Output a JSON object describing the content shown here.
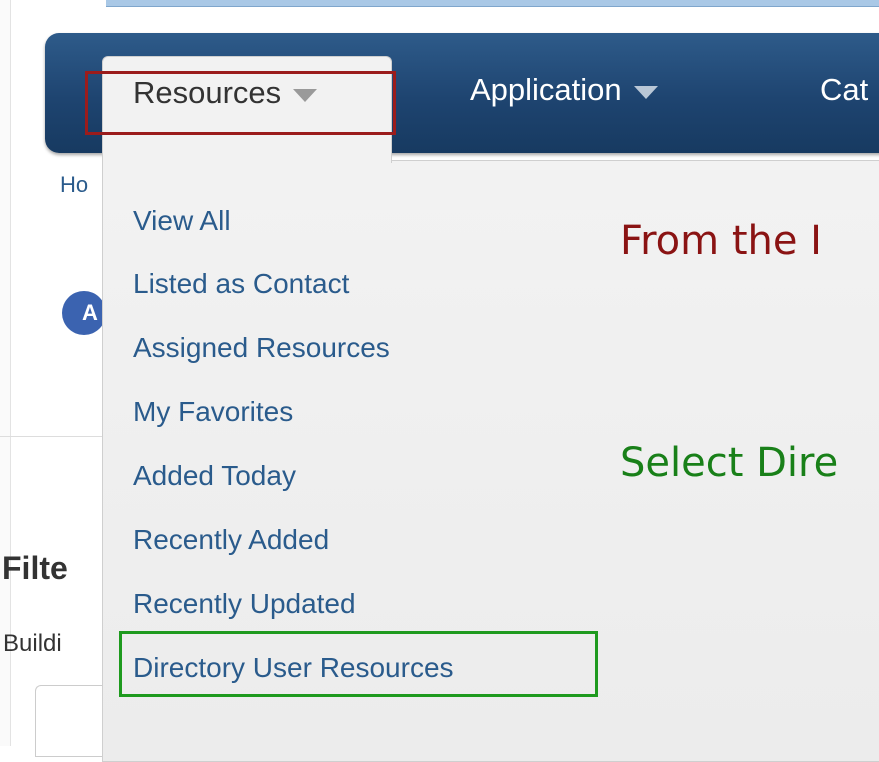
{
  "nav": {
    "items": [
      {
        "label": "Resources"
      },
      {
        "label": "Application"
      },
      {
        "label": "Cat"
      }
    ]
  },
  "breadcrumb": {
    "text": "Ho"
  },
  "avatar": {
    "text": "A"
  },
  "filter": {
    "heading": "Filte",
    "building_label": "Buildi"
  },
  "menu": {
    "items": [
      {
        "label": "View All"
      },
      {
        "label": "Listed as Contact"
      },
      {
        "label": "Assigned Resources"
      },
      {
        "label": "My Favorites"
      },
      {
        "label": "Added Today"
      },
      {
        "label": "Recently Added"
      },
      {
        "label": "Recently Updated"
      },
      {
        "label": "Directory User Resources"
      }
    ]
  },
  "annotations": {
    "instruction_1": "From the I",
    "instruction_2": "Select Dire"
  },
  "colors": {
    "navbar": "#1e4470",
    "link": "#2a5b8c",
    "highlight_red": "#9b1c1c",
    "highlight_green": "#1e9a1e"
  }
}
